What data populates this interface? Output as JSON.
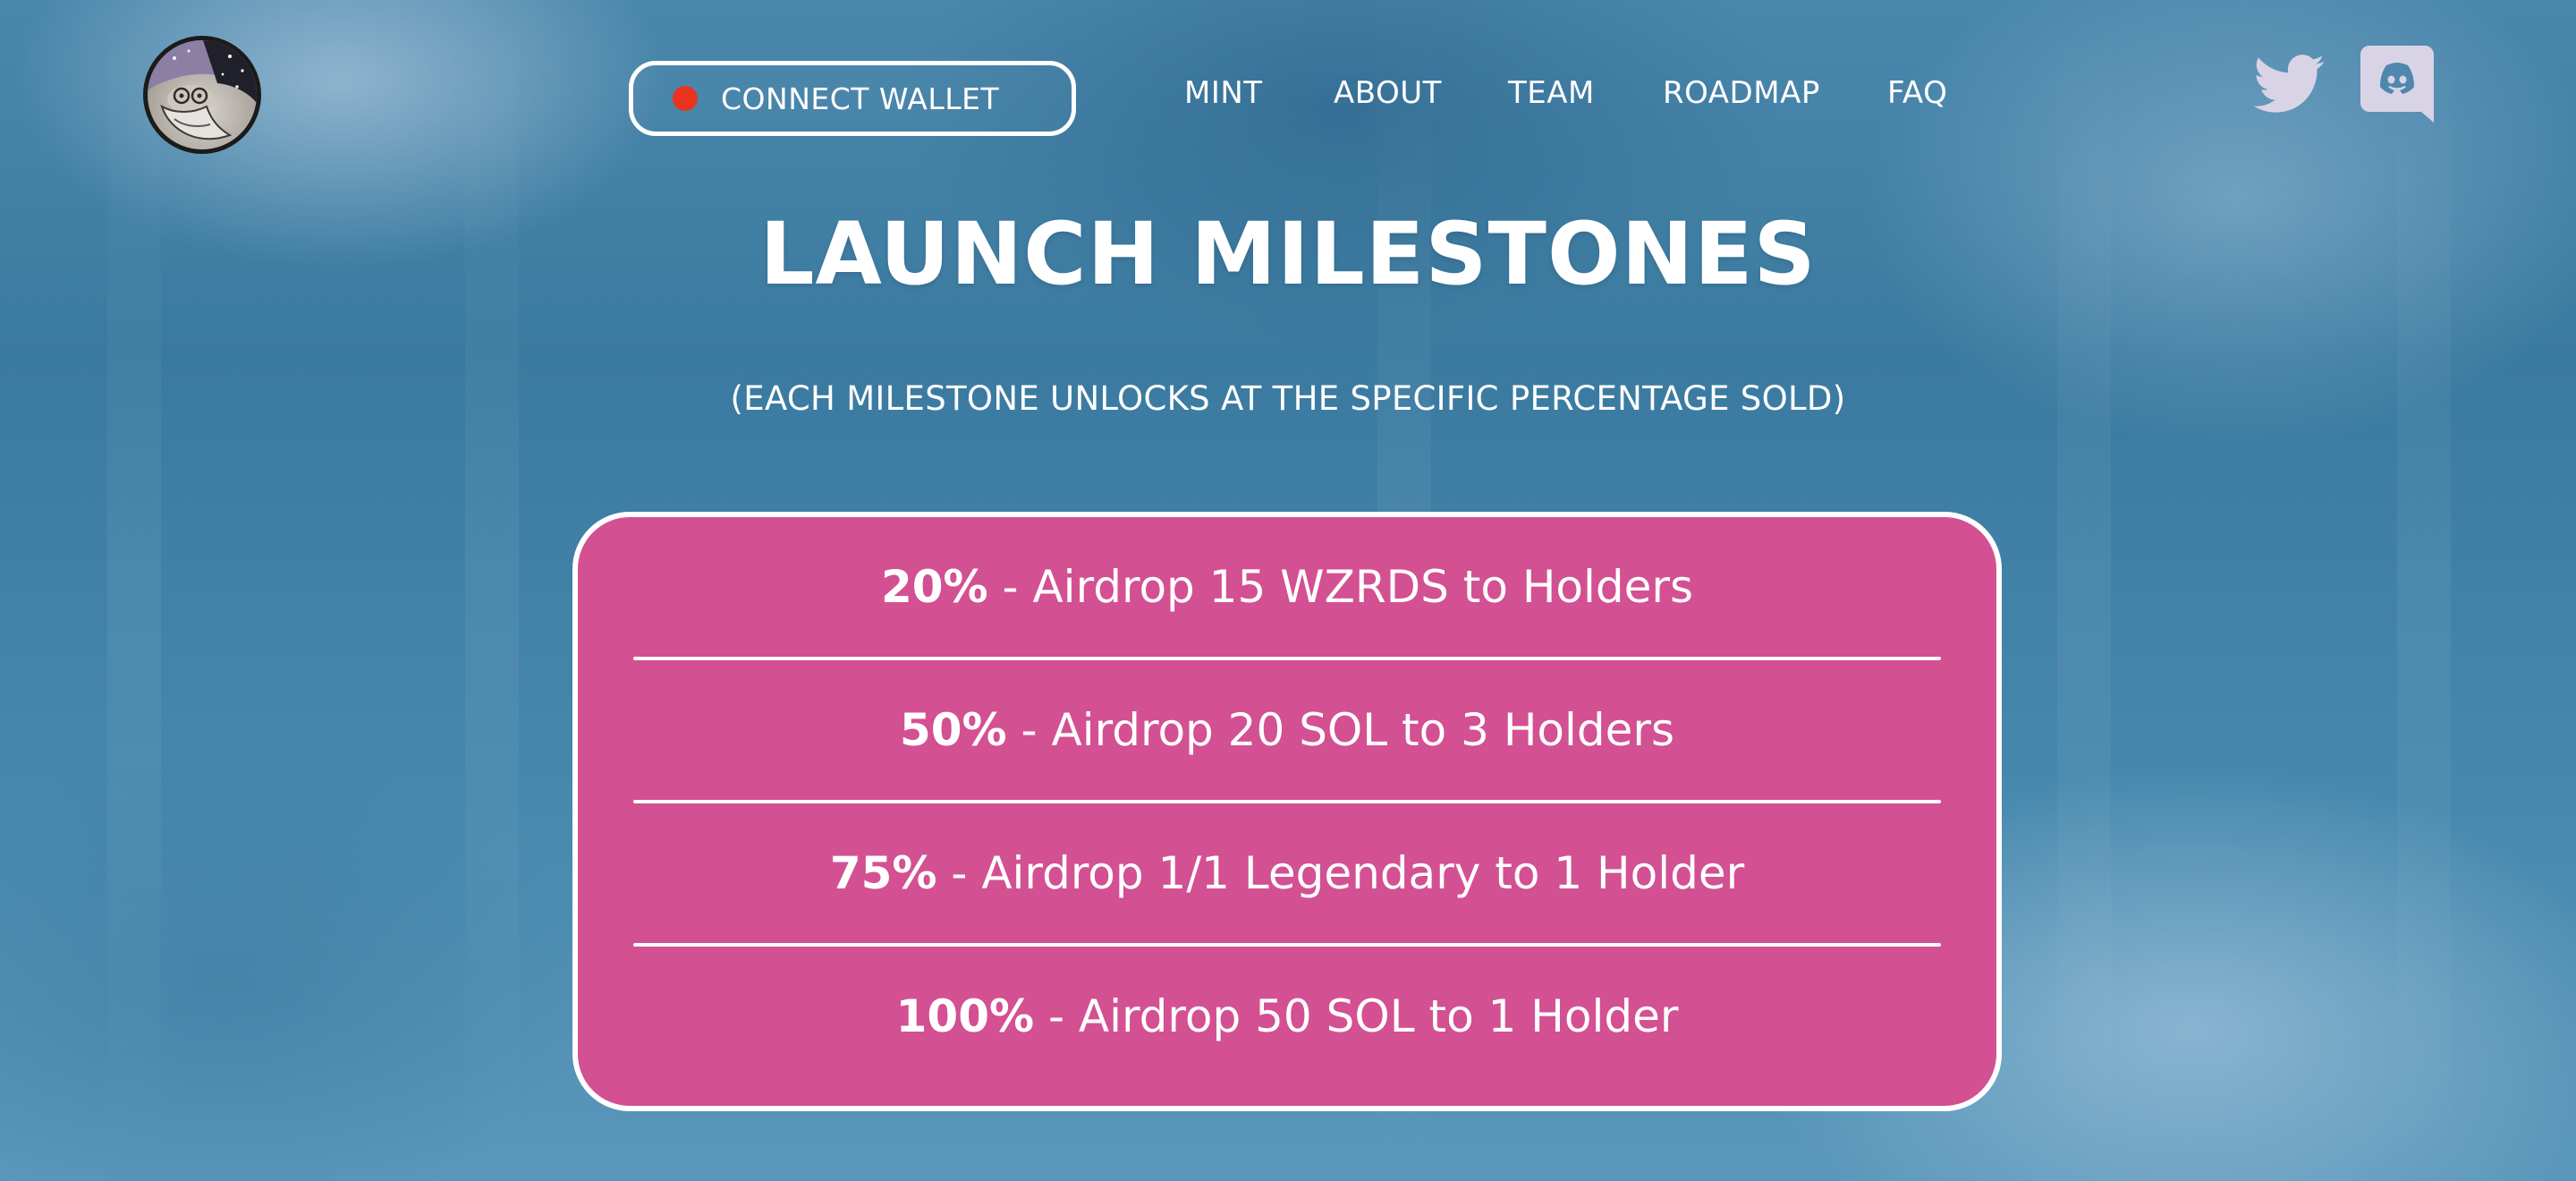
{
  "header": {
    "logo_icon": "wizard-logo-icon",
    "connect_button": {
      "label": "CONNECT WALLET",
      "status_color": "#e8341f"
    },
    "nav": [
      {
        "label": "MINT"
      },
      {
        "label": "ABOUT"
      },
      {
        "label": "TEAM"
      },
      {
        "label": "ROADMAP"
      },
      {
        "label": "FAQ"
      }
    ],
    "social": [
      {
        "icon": "twitter-icon"
      },
      {
        "icon": "discord-icon"
      }
    ]
  },
  "main": {
    "title": "LAUNCH MILESTONES",
    "subtitle": "(EACH MILESTONE UNLOCKS AT THE SPECIFIC PERCENTAGE SOLD)",
    "milestones": [
      {
        "percent": "20%",
        "text": " - Airdrop 15 WZRDS to Holders"
      },
      {
        "percent": "50%",
        "text": " - Airdrop 20 SOL to 3 Holders"
      },
      {
        "percent": "75%",
        "text": " - Airdrop 1/1 Legendary to 1 Holder"
      },
      {
        "percent": "100%",
        "text": " - Airdrop 50 SOL to 1 Holder"
      }
    ]
  },
  "colors": {
    "card_background": "#d35092",
    "social_icon": "#d9d3e6",
    "text": "#ffffff"
  }
}
